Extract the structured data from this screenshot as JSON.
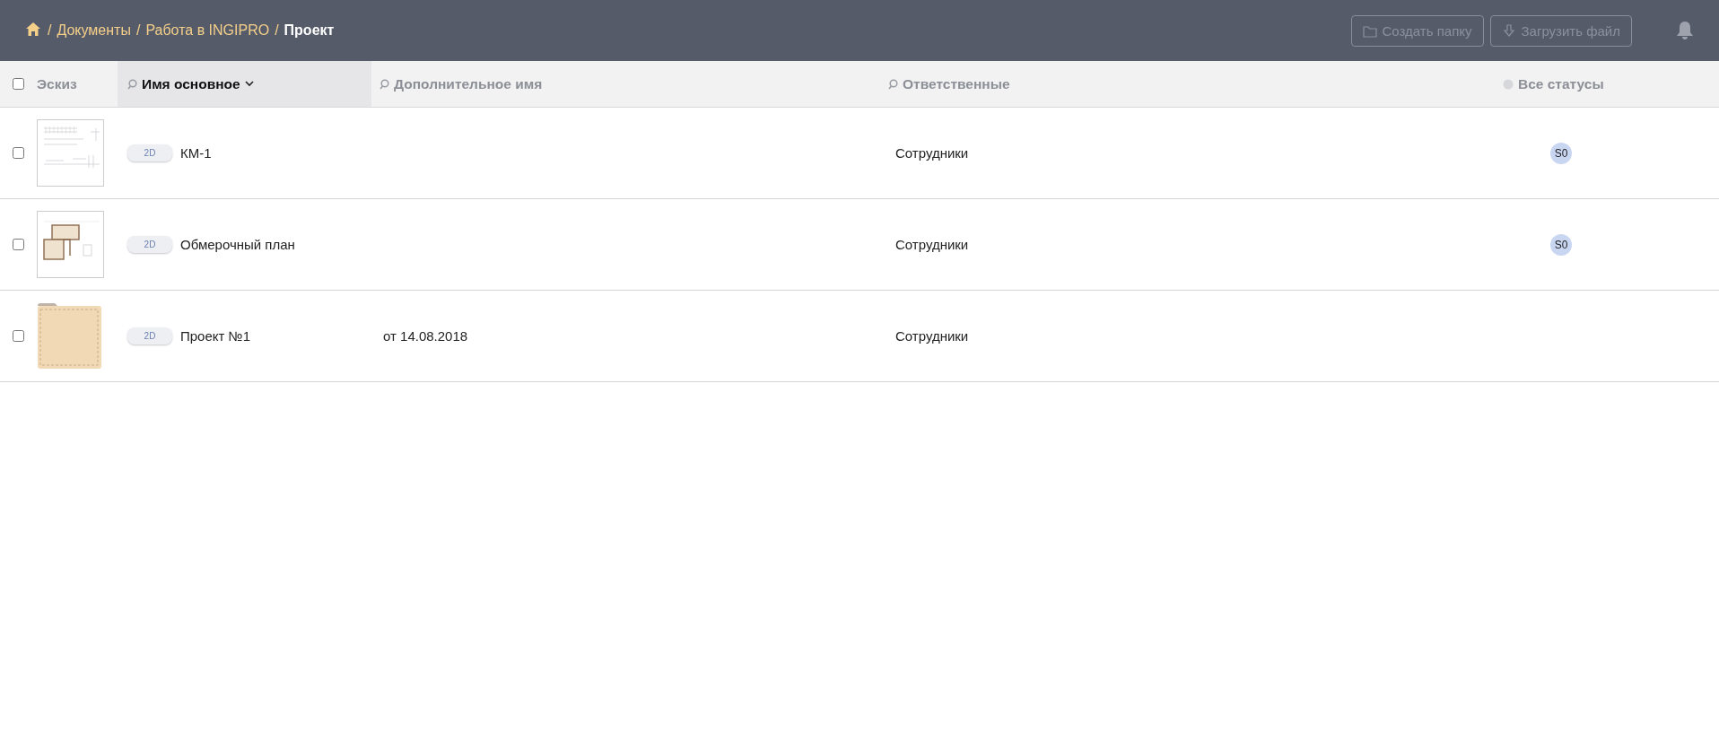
{
  "breadcrumbs": [
    {
      "separator": "/",
      "label": "Документы",
      "current": false
    },
    {
      "separator": "/",
      "label": "Работа в INGIPRO",
      "current": false
    },
    {
      "separator": "/",
      "label": "Проект",
      "current": true
    }
  ],
  "toolbar": {
    "buttons": [
      {
        "label": "Создать папку",
        "kind": "folder",
        "disabled": true
      },
      {
        "label": "Загрузить файл",
        "kind": "upload",
        "disabled": true
      }
    ]
  },
  "table": {
    "select_all": {
      "checked": false
    },
    "columns": [
      {
        "label": "Эскиз",
        "kind": "plain",
        "selected": false
      },
      {
        "label": "Имя основное",
        "kind": "search",
        "selected": true
      },
      {
        "label": "Дополнительное имя",
        "kind": "search",
        "selected": false
      },
      {
        "label": "Ответственные",
        "kind": "search",
        "selected": false
      },
      {
        "label": "Все статусы",
        "kind": "status",
        "selected": false
      }
    ],
    "rows": [
      {
        "checked": false,
        "sketch": {
          "kind": "sheet"
        },
        "type": "2D",
        "name": "КМ-1",
        "responsible": "Сотрудники",
        "status": "S0"
      },
      {
        "checked": false,
        "sketch": {
          "kind": "plan"
        },
        "type": "2D",
        "name": "Обмерочный план",
        "responsible": "Сотрудники",
        "status": "S0"
      },
      {
        "checked": false,
        "sketch": {
          "kind": "folder"
        },
        "type": "2D",
        "name": "Проект №1",
        "extra_name": "от 14.08.2018",
        "responsible": "Сотрудники"
      }
    ]
  }
}
